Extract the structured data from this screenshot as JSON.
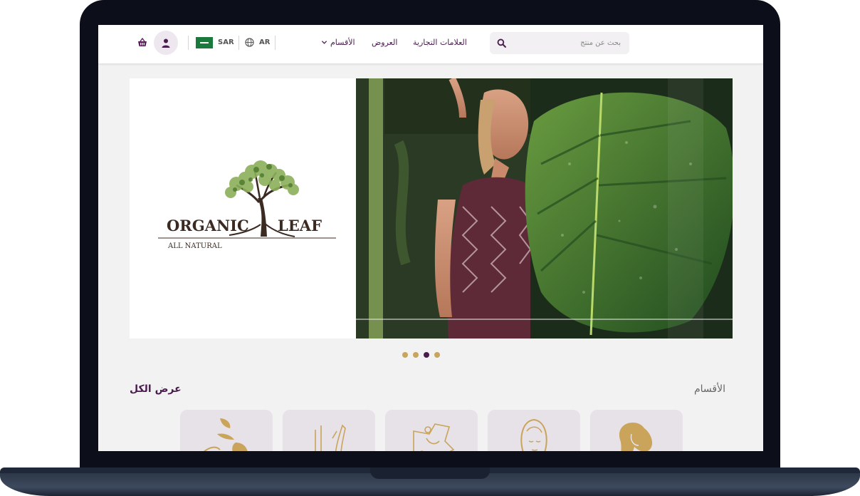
{
  "header": {
    "search_placeholder": "بحث عن منتج",
    "nav": {
      "brands": "العلامات التجارية",
      "offers": "العروض",
      "categories": "الأقسام"
    },
    "currency": "SAR",
    "language": "AR"
  },
  "banner": {
    "brand_name_left": "ORGANIC",
    "brand_name_right": "LEAF",
    "tagline": "ALL NATURAL",
    "slides_total": 4,
    "active_slide": 3
  },
  "categories_section": {
    "title": "الأقسام",
    "view_all": "عرض الكل",
    "items": [
      "hair-care",
      "face-care",
      "skin-care",
      "hand-care",
      "body-care"
    ]
  },
  "colors": {
    "primary": "#4a1c4e",
    "accent_gold": "#c9a45a",
    "category_bg": "#e7e2e8"
  },
  "icons": [
    "cart-icon",
    "user-icon",
    "flag-icon",
    "globe-icon",
    "chevron-down-icon",
    "search-icon"
  ]
}
